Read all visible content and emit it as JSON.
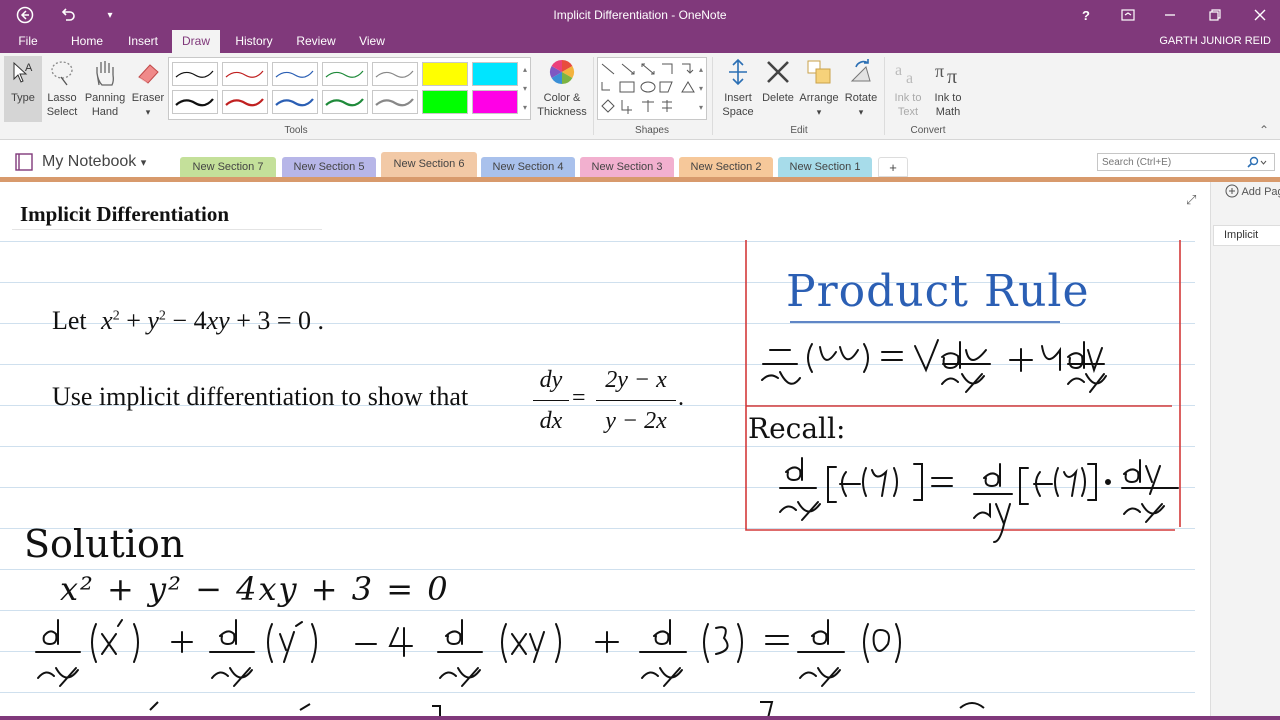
{
  "colors": {
    "accent": "#80397b",
    "ink_blue": "#2b5fb4",
    "box_red": "#d33a3a"
  },
  "window": {
    "title": "Implicit Differentiation - OneNote"
  },
  "titlebar": {
    "help": "?"
  },
  "tabs": [
    "File",
    "Home",
    "Insert",
    "Draw",
    "History",
    "Review",
    "View"
  ],
  "active_tab": "Draw",
  "user": "GARTH JUNIOR REID",
  "ribbon": {
    "type": "Type",
    "lasso": [
      "Lasso",
      "Select"
    ],
    "panning": [
      "Panning",
      "Hand"
    ],
    "eraser": "Eraser",
    "color": [
      "Color &",
      "Thickness"
    ],
    "insert_space": [
      "Insert",
      "Space"
    ],
    "delete": "Delete",
    "arrange": "Arrange",
    "rotate": "Rotate",
    "ink_to_text": [
      "Ink to",
      "Text"
    ],
    "ink_to_math": [
      "Ink to",
      "Math"
    ],
    "groups": {
      "tools": "Tools",
      "shapes": "Shapes",
      "edit": "Edit",
      "convert": "Convert"
    }
  },
  "notebook": "My Notebook",
  "sections": [
    {
      "label": "New Section 7",
      "color": "#c4e09a"
    },
    {
      "label": "New Section 5",
      "color": "#b7b6e8"
    },
    {
      "label": "New Section 6",
      "color": "#f2c9a6"
    },
    {
      "label": "New Section 4",
      "color": "#a9c1ec"
    },
    {
      "label": "New Section 3",
      "color": "#f2b0cf"
    },
    {
      "label": "New Section 2",
      "color": "#f6c89a"
    },
    {
      "label": "New Section 1",
      "color": "#a7dcea"
    }
  ],
  "add_section": "+",
  "search": {
    "placeholder": "Search (Ctrl+E)"
  },
  "page": {
    "title": "Implicit Differentiation",
    "let_word": "Let",
    "use_text": "Use implicit differentiation to show that",
    "dy": "dy",
    "dx": "dx",
    "numerator": "2y − x",
    "denominator": "y − 2x"
  },
  "ink": {
    "product_rule": "Product Rule",
    "recall": "Recall:",
    "solution": "Solution",
    "line1": "x² + y² − 4xy + 3 = 0"
  },
  "pagepanel": {
    "add_page": "Add Page",
    "page": "Implicit"
  }
}
